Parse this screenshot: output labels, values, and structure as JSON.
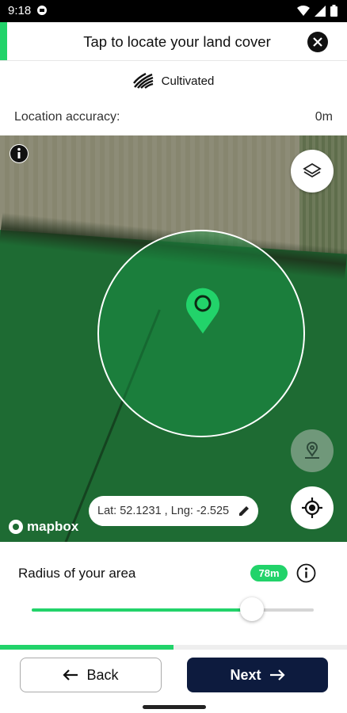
{
  "status_bar": {
    "time": "9:18"
  },
  "header": {
    "title": "Tap to locate your land cover",
    "accent_color": "#22d36a"
  },
  "cover_type": {
    "label": "Cultivated",
    "icon": "field-rows-icon"
  },
  "location_accuracy": {
    "label": "Location accuracy:",
    "value": "0m"
  },
  "map": {
    "coordinates": "Lat: 52.1231 , Lng: -2.525",
    "attribution": "mapbox",
    "buttons": [
      "info-icon",
      "layers-icon",
      "saved-location-icon",
      "crosshair-icon",
      "edit-icon"
    ]
  },
  "radius": {
    "label": "Radius of your area",
    "value_badge": "78m",
    "slider_fraction": 0.78
  },
  "progress": {
    "fraction": 0.5
  },
  "footer": {
    "back_label": "Back",
    "next_label": "Next"
  },
  "colors": {
    "accent": "#22d36a",
    "primary": "#0d1b3e"
  }
}
